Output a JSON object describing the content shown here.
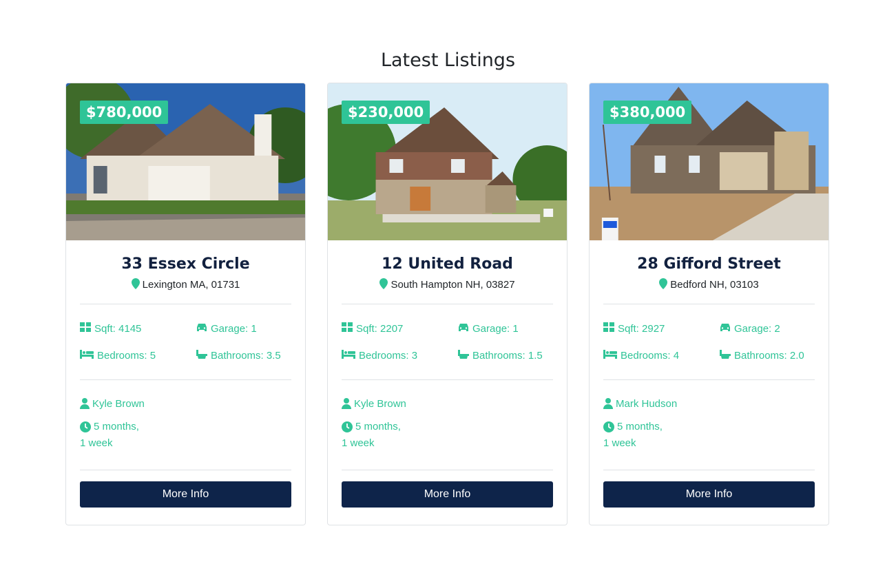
{
  "section": {
    "title": "Latest Listings"
  },
  "listings": [
    {
      "price": "$780,000",
      "title": "33 Essex Circle",
      "address": "Lexington MA, 01731",
      "sqft": "Sqft: 4145",
      "garage": "Garage: 1",
      "bedrooms": "Bedrooms: 5",
      "bathrooms": "Bathrooms: 3.5",
      "agent": "Kyle Brown",
      "time_line1": "5 months,",
      "time_line2": "1 week",
      "button": "More Info"
    },
    {
      "price": "$230,000",
      "title": "12 United Road",
      "address": "South Hampton NH, 03827",
      "sqft": "Sqft: 2207",
      "garage": "Garage: 1",
      "bedrooms": "Bedrooms: 3",
      "bathrooms": "Bathrooms: 1.5",
      "agent": "Kyle Brown",
      "time_line1": "5 months,",
      "time_line2": "1 week",
      "button": "More Info"
    },
    {
      "price": "$380,000",
      "title": "28 Gifford Street",
      "address": "Bedford NH, 03103",
      "sqft": "Sqft: 2927",
      "garage": "Garage: 2",
      "bedrooms": "Bedrooms: 4",
      "bathrooms": "Bathrooms: 2.0",
      "agent": "Mark Hudson",
      "time_line1": "5 months,",
      "time_line2": "1 week",
      "button": "More Info"
    }
  ],
  "icons": {
    "pin": "map-marker-icon",
    "sqft": "grid-icon",
    "garage": "car-icon",
    "bedrooms": "bed-icon",
    "bathrooms": "bath-icon",
    "agent": "user-icon",
    "time": "clock-icon"
  },
  "colors": {
    "accent": "#2fc497",
    "navy": "#0e244a",
    "title": "#12213f"
  }
}
